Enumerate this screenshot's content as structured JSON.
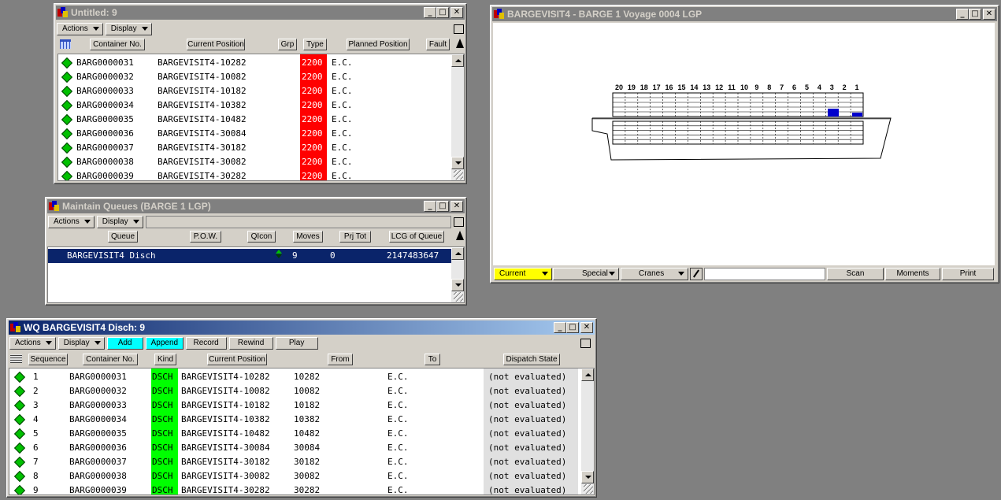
{
  "win1": {
    "title": "Untitled: 9",
    "actions": "Actions",
    "display": "Display",
    "headers": [
      "Container No.",
      "Current Position",
      "Grp",
      "Type",
      "Planned Position",
      "Fault"
    ],
    "rows": [
      {
        "container": "BARG0000031",
        "position": "BARGEVISIT4-10282",
        "type": "2200",
        "planned": "E.C."
      },
      {
        "container": "BARG0000032",
        "position": "BARGEVISIT4-10082",
        "type": "2200",
        "planned": "E.C."
      },
      {
        "container": "BARG0000033",
        "position": "BARGEVISIT4-10182",
        "type": "2200",
        "planned": "E.C."
      },
      {
        "container": "BARG0000034",
        "position": "BARGEVISIT4-10382",
        "type": "2200",
        "planned": "E.C."
      },
      {
        "container": "BARG0000035",
        "position": "BARGEVISIT4-10482",
        "type": "2200",
        "planned": "E.C."
      },
      {
        "container": "BARG0000036",
        "position": "BARGEVISIT4-30084",
        "type": "2200",
        "planned": "E.C."
      },
      {
        "container": "BARG0000037",
        "position": "BARGEVISIT4-30182",
        "type": "2200",
        "planned": "E.C."
      },
      {
        "container": "BARG0000038",
        "position": "BARGEVISIT4-30082",
        "type": "2200",
        "planned": "E.C."
      },
      {
        "container": "BARG0000039",
        "position": "BARGEVISIT4-30282",
        "type": "2200",
        "planned": "E.C."
      }
    ]
  },
  "win2": {
    "title": "Maintain Queues (BARGE 1 LGP)",
    "actions": "Actions",
    "display": "Display",
    "headers": [
      "Queue",
      "P.O.W.",
      "QIcon",
      "Moves",
      "Prj Tot",
      "LCG of Queue"
    ],
    "row": {
      "queue": "BARGEVISIT4 Disch",
      "moves": "9",
      "prj": "0",
      "lcg": "2147483647"
    }
  },
  "win3": {
    "title": "WQ BARGEVISIT4 Disch:  9",
    "actions": "Actions",
    "display": "Display",
    "add": "Add",
    "append": "Append",
    "record": "Record",
    "rewind": "Rewind",
    "play": "Play",
    "headers": [
      "Sequence",
      "Container No.",
      "Kind",
      "Current Position",
      "From",
      "To",
      "Dispatch State"
    ],
    "rows": [
      {
        "seq": "1",
        "container": "BARG0000031",
        "kind": "DSCH",
        "position": "BARGEVISIT4-10282",
        "from": "10282",
        "to": "E.C.",
        "state": "(not evaluated)"
      },
      {
        "seq": "2",
        "container": "BARG0000032",
        "kind": "DSCH",
        "position": "BARGEVISIT4-10082",
        "from": "10082",
        "to": "E.C.",
        "state": "(not evaluated)"
      },
      {
        "seq": "3",
        "container": "BARG0000033",
        "kind": "DSCH",
        "position": "BARGEVISIT4-10182",
        "from": "10182",
        "to": "E.C.",
        "state": "(not evaluated)"
      },
      {
        "seq": "4",
        "container": "BARG0000034",
        "kind": "DSCH",
        "position": "BARGEVISIT4-10382",
        "from": "10382",
        "to": "E.C.",
        "state": "(not evaluated)"
      },
      {
        "seq": "5",
        "container": "BARG0000035",
        "kind": "DSCH",
        "position": "BARGEVISIT4-10482",
        "from": "10482",
        "to": "E.C.",
        "state": "(not evaluated)"
      },
      {
        "seq": "6",
        "container": "BARG0000036",
        "kind": "DSCH",
        "position": "BARGEVISIT4-30084",
        "from": "30084",
        "to": "E.C.",
        "state": "(not evaluated)"
      },
      {
        "seq": "7",
        "container": "BARG0000037",
        "kind": "DSCH",
        "position": "BARGEVISIT4-30182",
        "from": "30182",
        "to": "E.C.",
        "state": "(not evaluated)"
      },
      {
        "seq": "8",
        "container": "BARG0000038",
        "kind": "DSCH",
        "position": "BARGEVISIT4-30082",
        "from": "30082",
        "to": "E.C.",
        "state": "(not evaluated)"
      },
      {
        "seq": "9",
        "container": "BARG0000039",
        "kind": "DSCH",
        "position": "BARGEVISIT4-30282",
        "from": "30282",
        "to": "E.C.",
        "state": "(not evaluated)"
      }
    ]
  },
  "win4": {
    "title": "BARGEVISIT4 - BARGE 1  Voyage 0004 LGP",
    "bays": [
      "20",
      "19",
      "18",
      "17",
      "16",
      "15",
      "14",
      "13",
      "12",
      "11",
      "10",
      "9",
      "8",
      "7",
      "6",
      "5",
      "4",
      "3",
      "2",
      "1"
    ],
    "current": "Current",
    "special": "Special",
    "cranes": "Cranes",
    "scan": "Scan",
    "moments": "Moments",
    "print": "Print"
  },
  "colors": {
    "type_cell": "#ff0000",
    "kind_cell": "#00ff00",
    "selected_row": "#0a246a",
    "container_slot": "#0000cc"
  }
}
